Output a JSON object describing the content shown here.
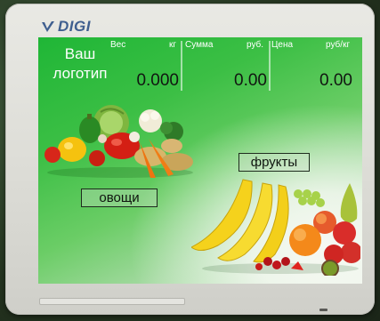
{
  "brand": {
    "name": "DIGI"
  },
  "display": {
    "logo_placeholder": "Ваш логотип",
    "weight": {
      "label": "Вес",
      "unit": "кг",
      "value": "0.000"
    },
    "total": {
      "label": "Сумма",
      "unit": "руб.",
      "value": "0.00"
    },
    "price": {
      "label": "Цена",
      "unit": "руб/кг",
      "value": "0.00"
    }
  },
  "categories": [
    {
      "label": "овощи",
      "icon": "vegetables-image"
    },
    {
      "label": "фрукты",
      "icon": "fruits-image"
    }
  ],
  "colors": {
    "screen_green": "#2fba3c",
    "brand_blue": "#3f5f8f",
    "bezel": "#dcdcd6"
  }
}
